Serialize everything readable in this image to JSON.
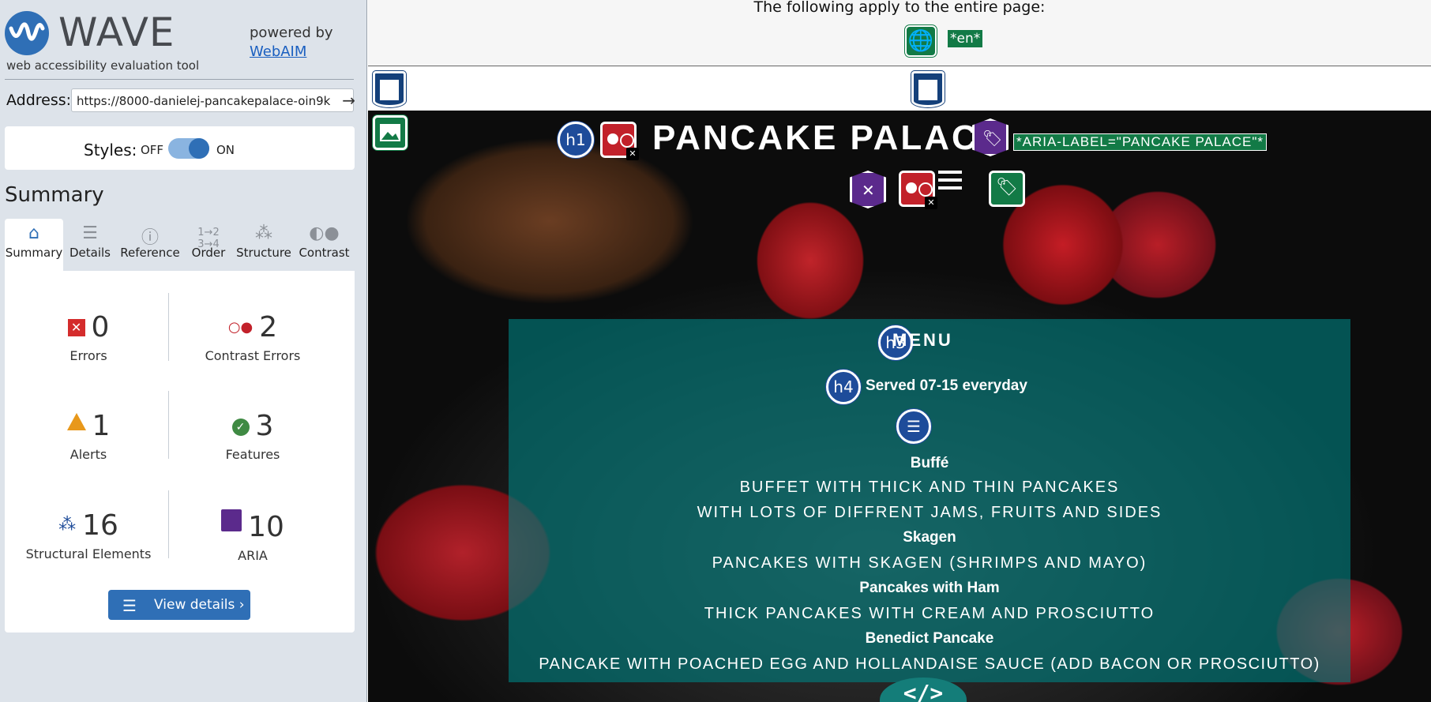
{
  "wave": {
    "logo_text": "WAVE",
    "tagline": "web accessibility evaluation tool",
    "powered_by": "powered by",
    "webaim_link": "WebAIM",
    "address_label": "Address:",
    "address_value": "https://8000-danielej-pancakepalace-oin9k",
    "styles_label": "Styles:",
    "styles_off": "OFF",
    "styles_on": "ON",
    "summary_heading": "Summary",
    "tabs": [
      {
        "label": "Summary",
        "icon": "home-icon"
      },
      {
        "label": "Details",
        "icon": "list-icon"
      },
      {
        "label": "Reference",
        "icon": "info-icon"
      },
      {
        "label": "Order",
        "icon": "order-icon"
      },
      {
        "label": "Structure",
        "icon": "structure-icon"
      },
      {
        "label": "Contrast",
        "icon": "contrast-icon"
      }
    ],
    "stats": {
      "errors": {
        "count": "0",
        "label": "Errors"
      },
      "contrast_errors": {
        "count": "2",
        "label": "Contrast Errors"
      },
      "alerts": {
        "count": "1",
        "label": "Alerts"
      },
      "features": {
        "count": "3",
        "label": "Features"
      },
      "structural": {
        "count": "16",
        "label": "Structural Elements"
      },
      "aria": {
        "count": "10",
        "label": "ARIA"
      }
    },
    "view_details": "View details ›"
  },
  "page": {
    "note": "The following apply to the entire page:",
    "lang_tag": "*en*",
    "h1_badge": "h1",
    "h3_badge": "h3",
    "h4_badge": "h4",
    "title": "PANCAKE PALACE",
    "aria_label_tag": "*ARIA-LABEL=\"PANCAKE PALACE\"*",
    "menu_heading": "MENU",
    "served": "Served 07-15 everyday",
    "items": [
      {
        "name": "Buffé",
        "desc_1": "BUFFET WITH THICK AND THIN PANCAKES",
        "desc_2": "WITH LOTS OF DIFFRENT JAMS, FRUITS AND SIDES"
      },
      {
        "name": "Skagen",
        "desc_1": "PANCAKES WITH SKAGEN (SHRIMPS AND MAYO)"
      },
      {
        "name": "Pancakes with Ham",
        "desc_1": "THICK PANCAKES WITH CREAM AND PROSCIUTTO"
      },
      {
        "name": "Benedict Pancake",
        "desc_1": "PANCAKE WITH POACHED EGG AND HOLLANDAISE SAUCE (ADD BACON OR PROSCIUTTO)"
      }
    ],
    "code_icon": "</>"
  },
  "colors": {
    "wave_blue": "#2f6fb6",
    "feature_green": "#127a46",
    "structure_navy": "#1e4c9a",
    "aria_purple": "#5b2a8c",
    "error_red": "#c2212a",
    "menu_teal": "#008080"
  }
}
